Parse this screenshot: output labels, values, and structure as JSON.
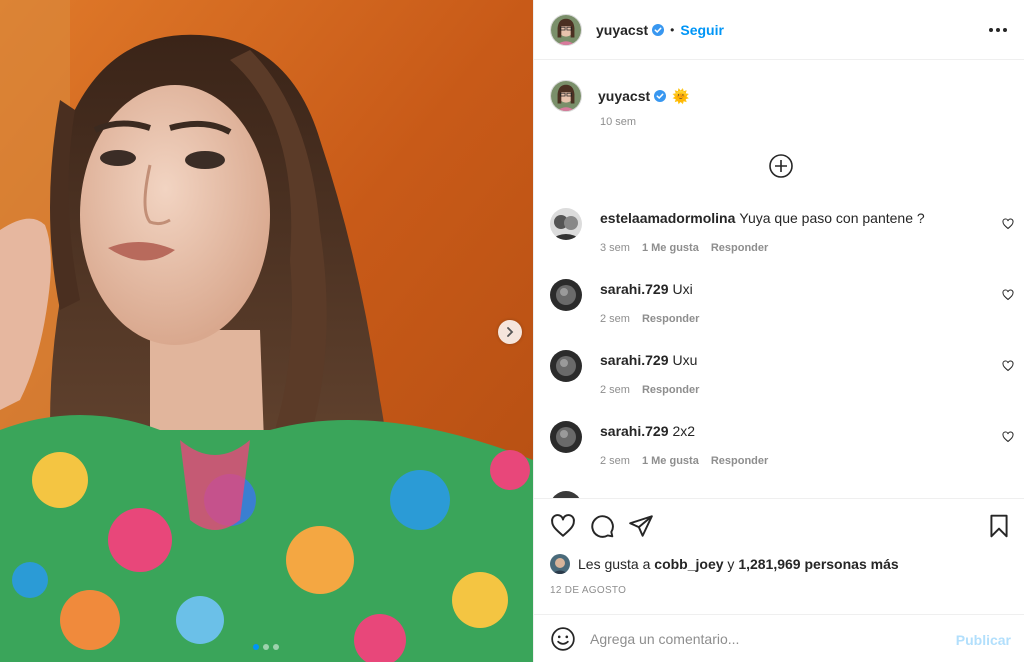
{
  "header": {
    "username": "yuyacst",
    "separator": "•",
    "follow_label": "Seguir",
    "more_icon": "more-options-icon"
  },
  "caption": {
    "username": "yuyacst",
    "emoji": "🌞",
    "time_ago": "10 sem"
  },
  "comments": [
    {
      "username": "estelaamadormolina",
      "text": "Yuya que paso con pantene ?",
      "time": "3 sem",
      "likes": "1 Me gusta",
      "reply": "Responder"
    },
    {
      "username": "sarahi.729",
      "text": "Uxi",
      "time": "2 sem",
      "likes": "",
      "reply": "Responder"
    },
    {
      "username": "sarahi.729",
      "text": "Uxu",
      "time": "2 sem",
      "likes": "",
      "reply": "Responder"
    },
    {
      "username": "sarahi.729",
      "text": "2x2",
      "time": "2 sem",
      "likes": "1 Me gusta",
      "reply": "Responder"
    }
  ],
  "likes": {
    "prefix": "Les gusta a",
    "user": "cobb_joey",
    "conj": "y",
    "count": "1,281,969 personas más"
  },
  "date": "12 DE AGOSTO",
  "add_comment": {
    "placeholder": "Agrega un comentario...",
    "publish_label": "Publicar"
  },
  "colors": {
    "accent": "#0095f6",
    "publish_disabled": "#b2dffc",
    "muted": "#8e8e8e",
    "text": "#262626"
  },
  "carousel": {
    "current_index": 1,
    "total": 3
  }
}
